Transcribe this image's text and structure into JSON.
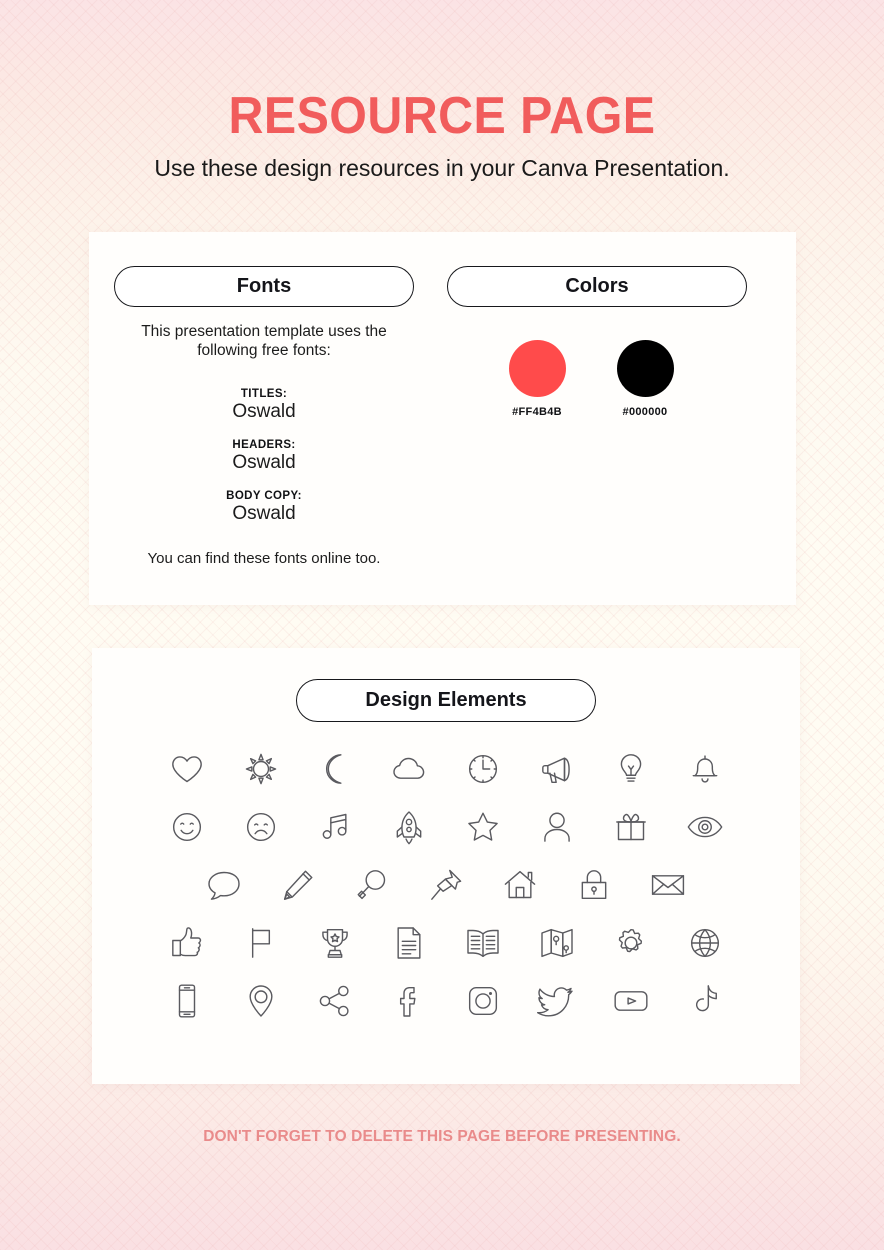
{
  "header": {
    "title": "RESOURCE PAGE",
    "subtitle": "Use these design resources in your Canva Presentation."
  },
  "fonts_panel": {
    "pill_label": "Fonts",
    "intro": "This presentation template uses the following free fonts:",
    "groups": [
      {
        "label": "TITLES:",
        "value": "Oswald"
      },
      {
        "label": "HEADERS:",
        "value": "Oswald"
      },
      {
        "label": "BODY COPY:",
        "value": "Oswald"
      }
    ],
    "outro": "You can find these fonts online too."
  },
  "colors_panel": {
    "pill_label": "Colors",
    "swatches": [
      {
        "hex": "#FF4B4B",
        "label": "#FF4B4B"
      },
      {
        "hex": "#000000",
        "label": "#000000"
      }
    ]
  },
  "design_elements_panel": {
    "pill_label": "Design Elements",
    "rows": [
      [
        "heart-icon",
        "sun-icon",
        "moon-icon",
        "cloud-icon",
        "clock-icon",
        "megaphone-icon",
        "lightbulb-icon",
        "bell-icon"
      ],
      [
        "smiley-icon",
        "sad-face-icon",
        "music-note-icon",
        "rocket-icon",
        "star-icon",
        "person-icon",
        "gift-icon",
        "eye-icon"
      ],
      [
        "speech-bubble-icon",
        "pencil-icon",
        "magnifier-icon",
        "pushpin-icon",
        "house-icon",
        "lock-icon",
        "envelope-icon"
      ],
      [
        "thumbs-up-icon",
        "flag-icon",
        "trophy-icon",
        "document-icon",
        "book-icon",
        "map-icon",
        "gear-icon",
        "globe-icon"
      ],
      [
        "phone-icon",
        "location-pin-icon",
        "share-icon",
        "facebook-icon",
        "instagram-icon",
        "twitter-icon",
        "youtube-icon",
        "tiktok-icon"
      ]
    ]
  },
  "footer": {
    "note": "DON'T FORGET TO DELETE THIS PAGE BEFORE PRESENTING."
  },
  "theme": {
    "accent": "#F15C5C",
    "footer_color": "#E98B8B",
    "icon_stroke": "#5a5a5f"
  }
}
